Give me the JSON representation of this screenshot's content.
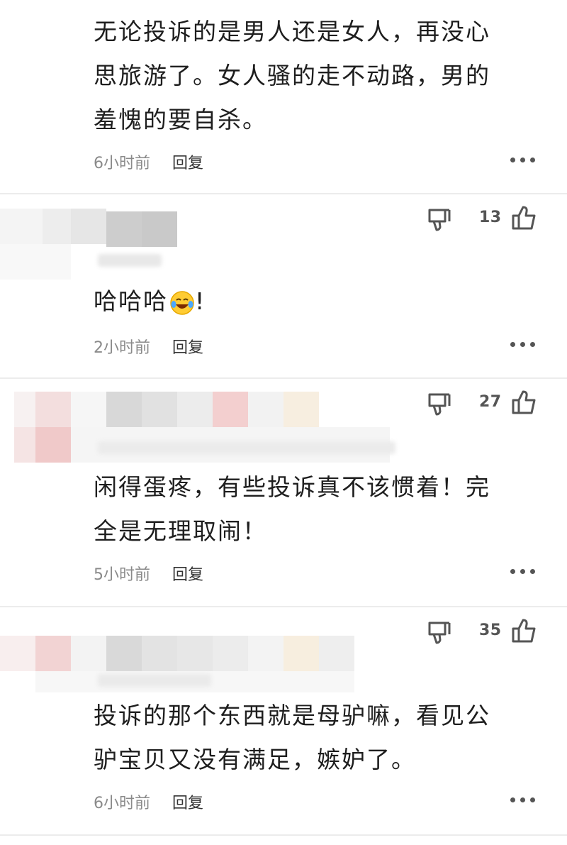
{
  "comments": [
    {
      "likes": "",
      "text_lines": [
        "无论投诉的是男人还是女人，再没心",
        "思旅游了。女人骚的走不动路，男的",
        "羞愧的要自杀。"
      ],
      "time": "6小时前",
      "reply_label": "回复"
    },
    {
      "likes": "13",
      "text_main": "哈哈哈",
      "emoji": "laughing-tears-emoji",
      "text_suffix": "!",
      "time": "2小时前",
      "reply_label": "回复"
    },
    {
      "likes": "27",
      "text_lines": [
        "闲得蛋疼，有些投诉真不该惯着！完",
        "全是无理取闹！"
      ],
      "time": "5小时前",
      "reply_label": "回复"
    },
    {
      "likes": "35",
      "text_lines": [
        "投诉的那个东西就是母驴嘛，看见公",
        "驴宝贝又没有满足，嫉妒了。"
      ],
      "time": "6小时前",
      "reply_label": "回复"
    }
  ],
  "icons": {
    "thumb_down": "thumb-down-icon",
    "thumb_up": "thumb-up-icon",
    "more": "more-icon"
  },
  "colors": {
    "text": "#1e1e1e",
    "meta": "#8a8a8a",
    "divider": "#ececec"
  }
}
